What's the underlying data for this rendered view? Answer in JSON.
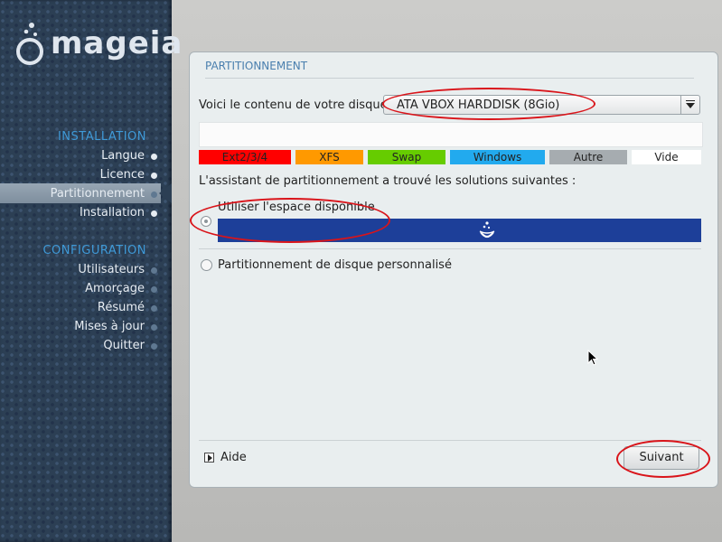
{
  "logo": {
    "text": "mageia"
  },
  "sidebar": {
    "sections": [
      {
        "title": "INSTALLATION",
        "items": [
          {
            "label": "Langue",
            "state": "done"
          },
          {
            "label": "Licence",
            "state": "done"
          },
          {
            "label": "Partitionnement",
            "state": "active"
          },
          {
            "label": "Installation",
            "state": "done"
          }
        ]
      },
      {
        "title": "CONFIGURATION",
        "items": [
          {
            "label": "Utilisateurs",
            "state": "pending"
          },
          {
            "label": "Amorçage",
            "state": "pending"
          },
          {
            "label": "Résumé",
            "state": "pending"
          },
          {
            "label": "Mises à jour",
            "state": "pending"
          },
          {
            "label": "Quitter",
            "state": "pending"
          }
        ]
      }
    ]
  },
  "panel": {
    "title": "PARTITIONNEMENT",
    "disk_label": "Voici le contenu de votre disque",
    "disk_select": {
      "value": "ATA VBOX HARDDISK (8Gio)"
    },
    "legend": [
      {
        "label": "Ext2/3/4",
        "color": "#ff0000"
      },
      {
        "label": "XFS",
        "color": "#ff9900"
      },
      {
        "label": "Swap",
        "color": "#66cc00"
      },
      {
        "label": "Windows",
        "color": "#22aaee"
      },
      {
        "label": "Autre",
        "color": "#a6acb0"
      },
      {
        "label": "Vide",
        "color": "#ffffff"
      }
    ],
    "solutions_label": "L'assistant de partitionnement a trouvé les solutions suivantes :",
    "options": [
      {
        "label": "Utiliser l'espace disponible",
        "selected": true
      },
      {
        "label": "Partitionnement de disque personnalisé",
        "selected": false
      }
    ],
    "help_label": "Aide",
    "next_label": "Suivant"
  },
  "colors": {
    "accent": "#3f9ad8",
    "annotation": "#d9141a",
    "option_bar": "#1d3f99"
  }
}
